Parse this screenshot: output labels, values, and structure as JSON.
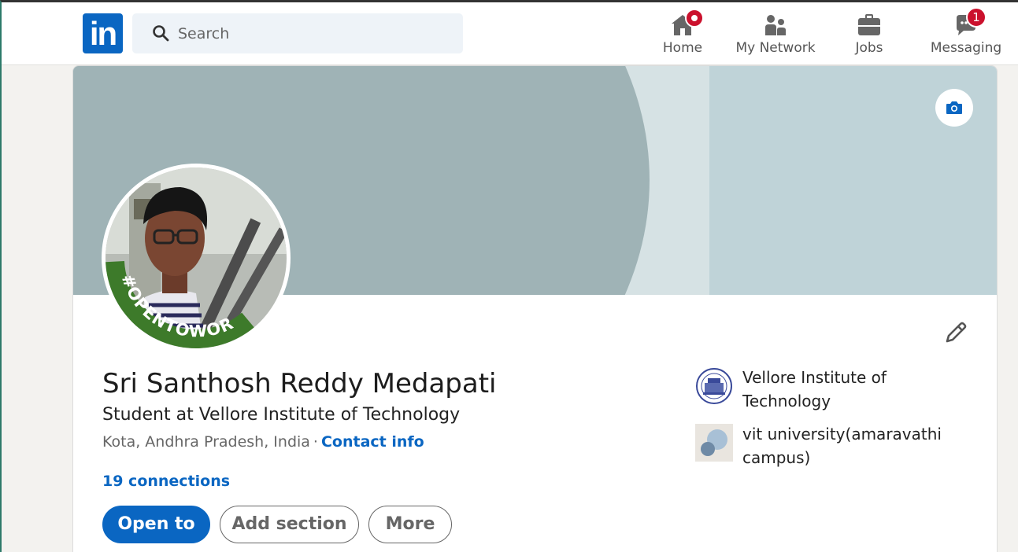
{
  "nav": {
    "logo_text": "in",
    "search_placeholder": "Search",
    "items": [
      {
        "label": "Home",
        "icon": "home-icon",
        "badge": ""
      },
      {
        "label": "My Network",
        "icon": "network-icon",
        "badge": ""
      },
      {
        "label": "Jobs",
        "icon": "briefcase-icon",
        "badge": ""
      },
      {
        "label": "Messaging",
        "icon": "messaging-icon",
        "badge": "1"
      }
    ]
  },
  "profile": {
    "avatar_frame_text": "#OPENTOWORK",
    "name": "Sri Santhosh Reddy Medapati",
    "headline": "Student at Vellore Institute of Technology",
    "location": "Kota, Andhra Pradesh, India",
    "separator": "·",
    "contact_label": "Contact info",
    "connections": "19 connections",
    "buttons": {
      "open_to": "Open to",
      "add_section": "Add section",
      "more": "More"
    },
    "education": [
      {
        "name": "Vellore Institute of Technology",
        "logo": "vit-seal-logo"
      },
      {
        "name": "vit university(amaravathi campus)",
        "logo": "placeholder-school-logo"
      }
    ]
  },
  "colors": {
    "brand": "#0a66c2",
    "badge": "#cb112d",
    "opentowork_green": "#3d7a2a"
  }
}
